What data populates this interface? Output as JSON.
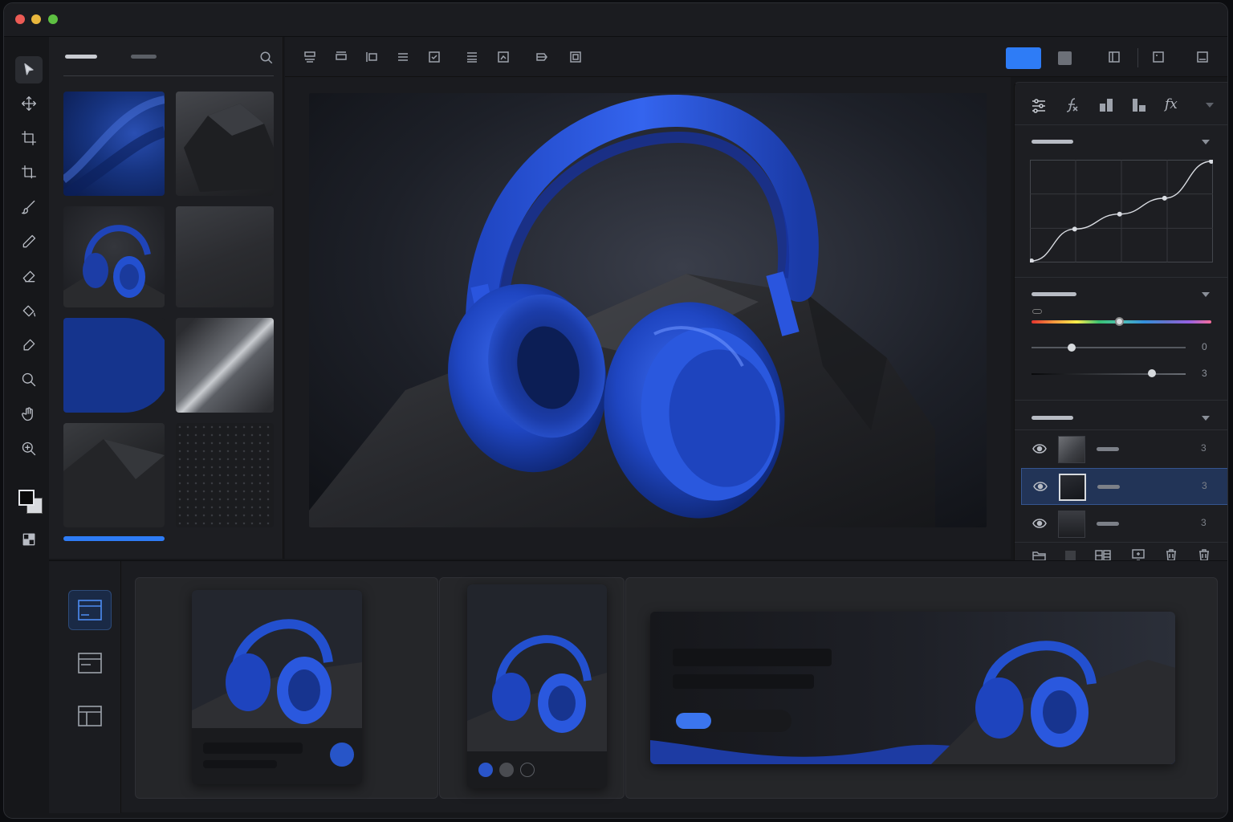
{
  "window": {
    "controls": [
      "close",
      "minimize",
      "zoom"
    ]
  },
  "tools": [
    "select-arrow-icon",
    "move-icon",
    "crop-icon",
    "crop-alt-icon",
    "brush-icon",
    "pencil-icon",
    "eraser-icon",
    "fill-bucket-icon",
    "pen-icon",
    "zoom-icon",
    "hand-icon",
    "magnify-icon",
    "color-swatches-icon",
    "mask-icon"
  ],
  "accent": "#2e7cf6",
  "library": {
    "active_tab_index": 0,
    "search_icon": "search-icon"
  },
  "toolbar": {
    "icons": [
      "align-top-icon",
      "align-middle-icon",
      "align-left-icon",
      "align-center-icon",
      "checkbox-icon",
      "list-icon",
      "image-icon",
      "layer-flip-icon",
      "frame-icon"
    ],
    "view_icons": [
      "single-view-icon",
      "split-view-icon",
      "panel-view-icon",
      "bottom-panel-icon"
    ]
  },
  "inspector": {
    "tabs": [
      "adjust-icon",
      "fx-script-icon",
      "histogram-icon",
      "shapes-icon",
      "fx-icon"
    ],
    "fx_label": "fx",
    "curve_points": [
      [
        0,
        0
      ],
      [
        0.24,
        0.32
      ],
      [
        0.49,
        0.47
      ],
      [
        0.74,
        0.63
      ],
      [
        1,
        1
      ]
    ],
    "hue_slider": 0.49,
    "slider2": {
      "value": 0.26,
      "readout": "0"
    },
    "slider3": {
      "value": 0.78,
      "readout": "3"
    }
  },
  "layers": [
    {
      "visible": true,
      "selected": false,
      "count": "3"
    },
    {
      "visible": true,
      "selected": true,
      "count": "3"
    },
    {
      "visible": true,
      "selected": false,
      "count": "3"
    }
  ],
  "layer_actions": [
    "group-icon",
    "mask-square-icon",
    "adjustment-icon",
    "new-layer-icon",
    "trash-icon",
    "delete-icon"
  ],
  "bottom": {
    "layout_icons": [
      "layout-card-icon",
      "layout-list-icon",
      "layout-grid-icon"
    ],
    "active_layout": 0
  }
}
